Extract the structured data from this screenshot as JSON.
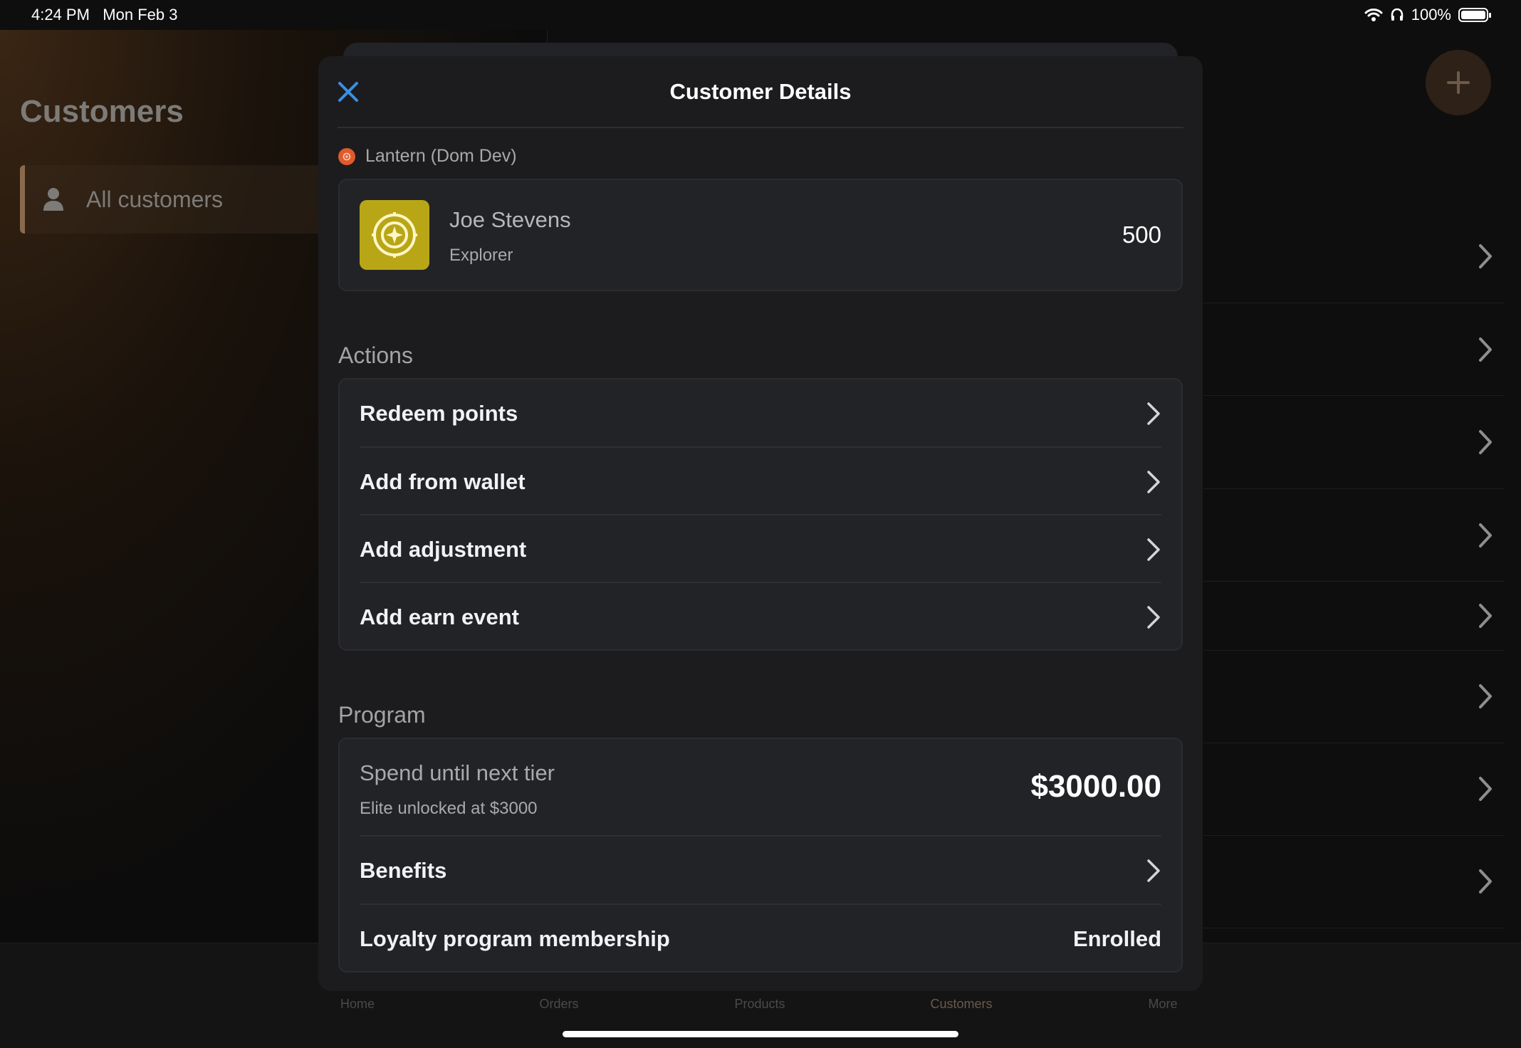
{
  "status_bar": {
    "time": "4:24 PM",
    "date": "Mon Feb 3",
    "battery": "100%"
  },
  "background": {
    "sidebar_title": "Customers",
    "sidebar_item": "All customers",
    "tabs": [
      {
        "label": "Home"
      },
      {
        "label": "Orders"
      },
      {
        "label": "Products"
      },
      {
        "label": "Customers"
      },
      {
        "label": "More"
      }
    ]
  },
  "modal": {
    "title": "Customer Details",
    "brand": "Lantern (Dom Dev)",
    "customer": {
      "name": "Joe Stevens",
      "tier": "Explorer",
      "points": "500"
    },
    "actions_label": "Actions",
    "actions": [
      {
        "label": "Redeem points"
      },
      {
        "label": "Add from wallet"
      },
      {
        "label": "Add adjustment"
      },
      {
        "label": "Add earn event"
      }
    ],
    "program_label": "Program",
    "program": {
      "spend_title": "Spend until next tier",
      "spend_subtitle": "Elite unlocked at $3000",
      "spend_value": "$3000.00",
      "benefits_label": "Benefits",
      "membership_label": "Loyalty program membership",
      "membership_value": "Enrolled"
    }
  },
  "colors": {
    "accent_close": "#3b8fe0",
    "avatar_bg": "#b9a617",
    "brand_dot": "#e05a2a"
  }
}
